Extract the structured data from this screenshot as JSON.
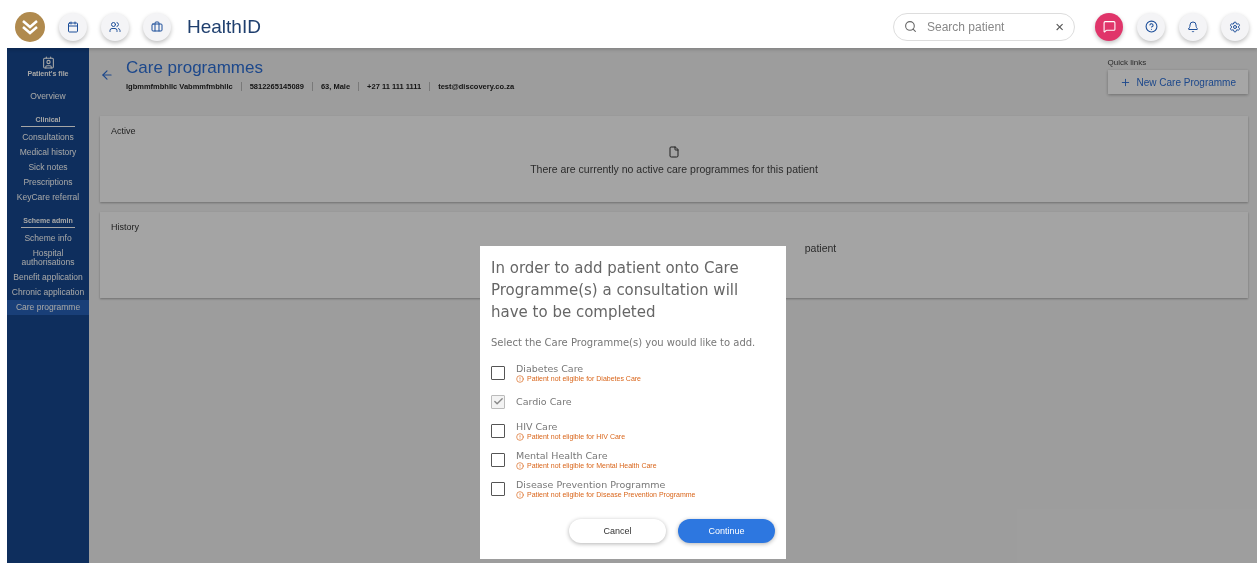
{
  "header": {
    "title": "HealthID",
    "search": {
      "placeholder": "Search patient",
      "clear": "×"
    }
  },
  "sidebar": {
    "file_label": "Patient's file",
    "items": [
      {
        "label": "Overview",
        "selected": false
      }
    ],
    "sections": [
      {
        "title": "Clinical",
        "items": [
          {
            "label": "Consultations",
            "selected": false
          },
          {
            "label": "Medical history",
            "selected": false
          },
          {
            "label": "Sick notes",
            "selected": false
          },
          {
            "label": "Prescriptions",
            "selected": false
          },
          {
            "label": "KeyCare referral",
            "selected": false
          }
        ]
      },
      {
        "title": "Scheme admin",
        "items": [
          {
            "label": "Scheme info",
            "selected": false
          },
          {
            "label": "Hospital authorisations",
            "selected": false
          },
          {
            "label": "Benefit application",
            "selected": false
          },
          {
            "label": "Chronic application",
            "selected": false
          },
          {
            "label": "Care programme",
            "selected": true
          }
        ]
      }
    ]
  },
  "page": {
    "title": "Care programmes",
    "patient": [
      "Igbmmfmbhllc Vabmmfmbhllc",
      "5812265145089",
      "63, Male",
      "+27 11 111 1111",
      "test@discovery.co.za"
    ],
    "quick_links": "Quick links",
    "new_button": "New Care Programme",
    "sections": [
      {
        "title": "Active",
        "empty_text": "There are currently no active care programmes for this patient",
        "show_icon": true
      },
      {
        "title": "History",
        "empty_text": "patient",
        "show_icon": false
      }
    ]
  },
  "dialog": {
    "title": "In order to add patient onto Care Programme(s) a consultation will have to be completed",
    "prompt": "Select the Care Programme(s) you would like to add.",
    "options": [
      {
        "label": "Diabetes Care",
        "checked": false,
        "warning": "Patient not eligible for Diabetes Care"
      },
      {
        "label": "Cardio Care",
        "checked": true
      },
      {
        "label": "HIV Care",
        "checked": false,
        "warning": "Patient not eligible for HIV Care"
      },
      {
        "label": "Mental Health Care",
        "checked": false,
        "warning": "Patient not eligible for Mental Health Care"
      },
      {
        "label": "Disease Prevention Programme",
        "checked": false,
        "warning": "Patient not eligible for Disease Prevention Programme"
      }
    ],
    "cancel": "Cancel",
    "continue": "Continue"
  }
}
